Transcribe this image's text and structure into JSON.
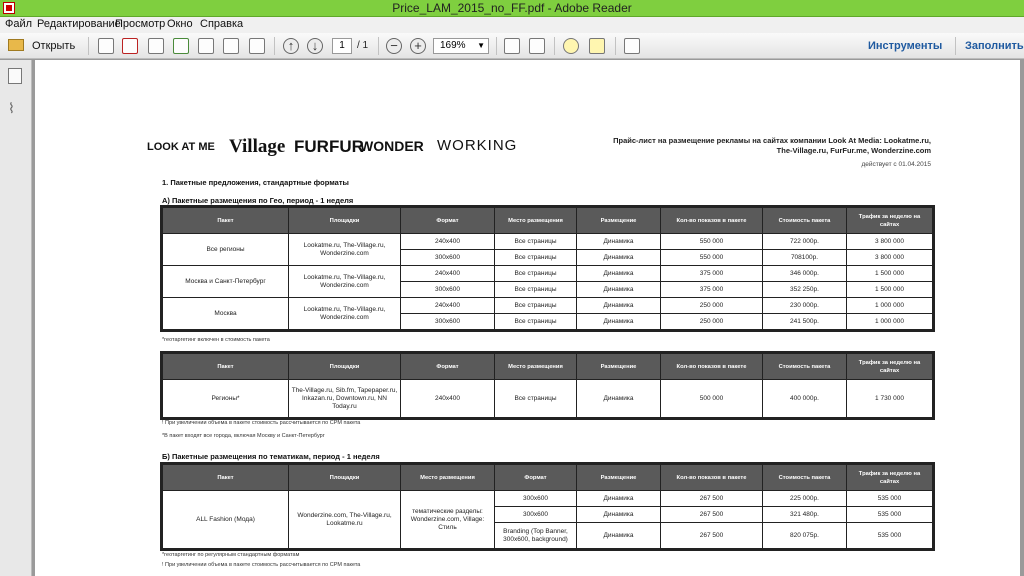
{
  "window": {
    "title": "Price_LAM_2015_no_FF.pdf - Adobe Reader"
  },
  "menu": [
    "Файл",
    "Редактирование",
    "Просмотр",
    "Окно",
    "Справка"
  ],
  "toolbar": {
    "open_label": "Открыть",
    "page_current": "1",
    "page_total": "/ 1",
    "zoom": "169%",
    "tools_label": "Инструменты",
    "fill_label": "Заполнить"
  },
  "brands": [
    "LOOK AT ME",
    "Village",
    "FURFUR",
    "WONDER",
    "WORKING"
  ],
  "header": {
    "line1": "Прайс-лист на размещение рекламы на сайтах компании Look At Media: Lookatme.ru,",
    "line2": "The-Village.ru, FurFur.me, Wonderzine.com",
    "valid": "действует с 01.04.2015"
  },
  "sections": {
    "s1": "1. Пакетные предложения, стандартные форматы",
    "a": "А) Пакетные размещения по Гео, период - 1 неделя",
    "b": "Б) Пакетные размещения по тематикам, период - 1 неделя"
  },
  "table1": {
    "headers": [
      "Пакет",
      "Площадки",
      "Формат",
      "Место размещения",
      "Размещение",
      "Кол-во показов в пакете",
      "Стоимость пакета",
      "Трафик за неделю на сайтах"
    ],
    "groups": [
      {
        "package": "Все регионы",
        "sites": "Lookatme.ru, The-Village.ru, Wonderzine.com",
        "traffic": "3 800 000",
        "rows": [
          [
            "240x400",
            "Все страницы",
            "Динамика",
            "550 000",
            "722 000р."
          ],
          [
            "300x600",
            "Все страницы",
            "Динамика",
            "550 000",
            "708100р."
          ]
        ],
        "traffic2": "3 800 000"
      },
      {
        "package": "Москва и Санкт-Петербург",
        "sites": "Lookatme.ru, The-Village.ru, Wonderzine.com",
        "traffic": "1 500 000",
        "rows": [
          [
            "240x400",
            "Все страницы",
            "Динамика",
            "375 000",
            "346 000р."
          ],
          [
            "300x600",
            "Все страницы",
            "Динамика",
            "375 000",
            "352 250р."
          ]
        ],
        "traffic2": "1 500 000"
      },
      {
        "package": "Москва",
        "sites": "Lookatme.ru, The-Village.ru, Wonderzine.com",
        "traffic": "1 000 000",
        "rows": [
          [
            "240x400",
            "Все страницы",
            "Динамика",
            "250 000",
            "230 000р."
          ],
          [
            "300x600",
            "Все страницы",
            "Динамика",
            "250 000",
            "241 500р."
          ]
        ],
        "traffic2": "1 000 000"
      }
    ],
    "note": "*геотаргетинг включен в стоимость пакета"
  },
  "table2": {
    "headers": [
      "Пакет",
      "Площадки",
      "Формат",
      "Место размещения",
      "Размещение",
      "Кол-во показов в пакете",
      "Стоимость пакета",
      "Трафик за неделю на сайтах"
    ],
    "row": [
      "Регионы*",
      "The-Village.ru, Sib.fm, Tapepaper.ru, Inkazan.ru, Downtown.ru, NN Today.ru",
      "240x400",
      "Все страницы",
      "Динамика",
      "500 000",
      "400 000р.",
      "1 730 000"
    ],
    "note1": "! При увеличении объема в пакете стоимость рассчитывается по CPM пакета",
    "note2": "*В пакет входят все города, включая Москву и Санкт-Петербург"
  },
  "table3": {
    "headers": [
      "Пакет",
      "Площадки",
      "Место размещения",
      "Формат",
      "Размещение",
      "Кол-во показов в пакете",
      "Стоимость пакета",
      "Трафик за неделю на сайтах"
    ],
    "package": "ALL Fashion (Мода)",
    "sites": "Wonderzine.com, The-Village.ru, Lookatme.ru",
    "place": "тематические разделы: Wonderzine.com, Village: Стиль",
    "rows": [
      [
        "300x600",
        "Динамика",
        "267 500",
        "225 000р.",
        "535 000"
      ],
      [
        "300x600",
        "Динамика",
        "267 500",
        "321 480р.",
        "535 000"
      ],
      [
        "Branding (Top Banner, 300x600, background)",
        "Динамика",
        "267 500",
        "820 075р.",
        "535 000"
      ]
    ],
    "note1": "*геотаргетинг по регулярным стандартным форматам",
    "note2": "! При увеличении объема в пакете стоимость рассчитывается по CPM пакета"
  }
}
